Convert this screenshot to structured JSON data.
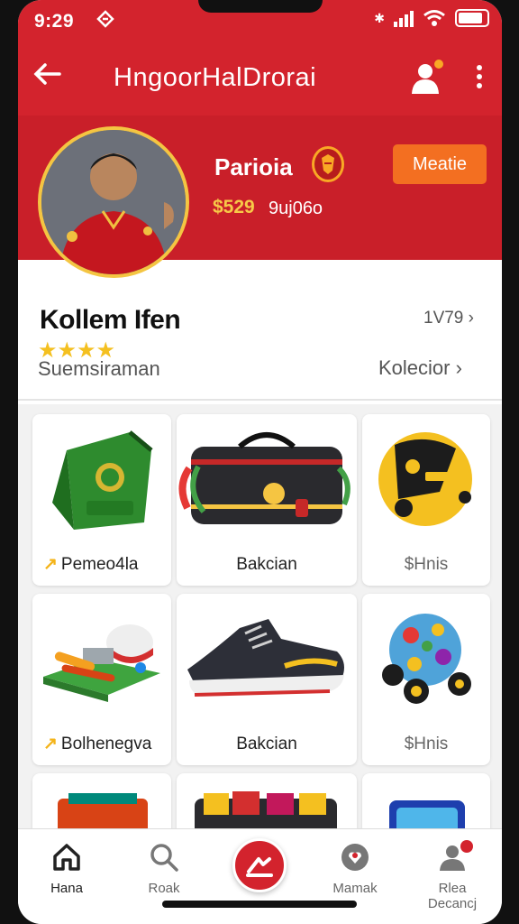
{
  "status_bar": {
    "time": "9:29"
  },
  "header": {
    "title": "HngoorHalDrorai"
  },
  "profile": {
    "name": "Parioia",
    "price": "$529",
    "sub_label": "9uj06o",
    "action_label": "Meatie"
  },
  "collection": {
    "title": "Kollem Ifen",
    "count": "1V79",
    "rating_stars": "★★★★",
    "subtitle": "Suemsiraman",
    "link_label": "Kolecior"
  },
  "products": [
    {
      "label": "Pemeo4la",
      "icon": "green-bag-icon"
    },
    {
      "label": "Bakcian",
      "icon": "black-duffel-bag-icon"
    },
    {
      "label": "Hnis",
      "prefix": "$",
      "icon": "yellow-ball-icon"
    },
    {
      "label": "Bolhenegva",
      "icon": "toy-set-icon"
    },
    {
      "label": "Bakcian",
      "icon": "sneaker-icon"
    },
    {
      "label": "Hnis",
      "prefix": "$",
      "icon": "toy-ball-icon"
    }
  ],
  "bottom_nav": {
    "home": "Hana",
    "search": "Roak",
    "market": "Mamak",
    "profile_line1": "Rlea",
    "profile_line2": "Decancj"
  },
  "colors": {
    "brand_red": "#d3232d",
    "accent_orange": "#f36f21",
    "star_yellow": "#f4c020"
  }
}
